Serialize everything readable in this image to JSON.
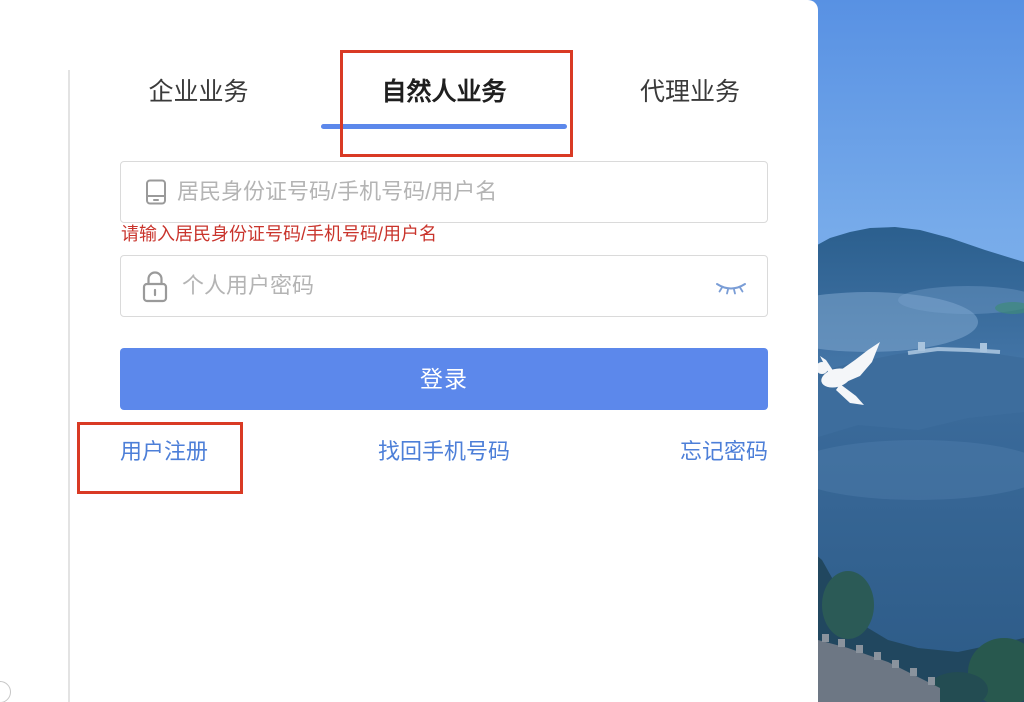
{
  "tabs": [
    {
      "label": "企业业务",
      "active": false
    },
    {
      "label": "自然人业务",
      "active": true
    },
    {
      "label": "代理业务",
      "active": false
    }
  ],
  "account_input": {
    "icon": "mobile-phone-icon",
    "placeholder": "居民身份证号码/手机号码/用户名",
    "value": "",
    "error": "请输入居民身份证号码/手机号码/用户名"
  },
  "password_input": {
    "icon": "lock-icon",
    "toggle_icon": "eye-closed-icon",
    "placeholder": "个人用户密码",
    "value": ""
  },
  "login_button": {
    "label": "登录"
  },
  "links": {
    "register": "用户注册",
    "recover_phone": "找回手机号码",
    "forgot_password": "忘记密码"
  },
  "colors": {
    "accent": "#5c88eb",
    "link": "#4d7fd8",
    "error": "#c9342c",
    "highlight": "#d93a24"
  }
}
